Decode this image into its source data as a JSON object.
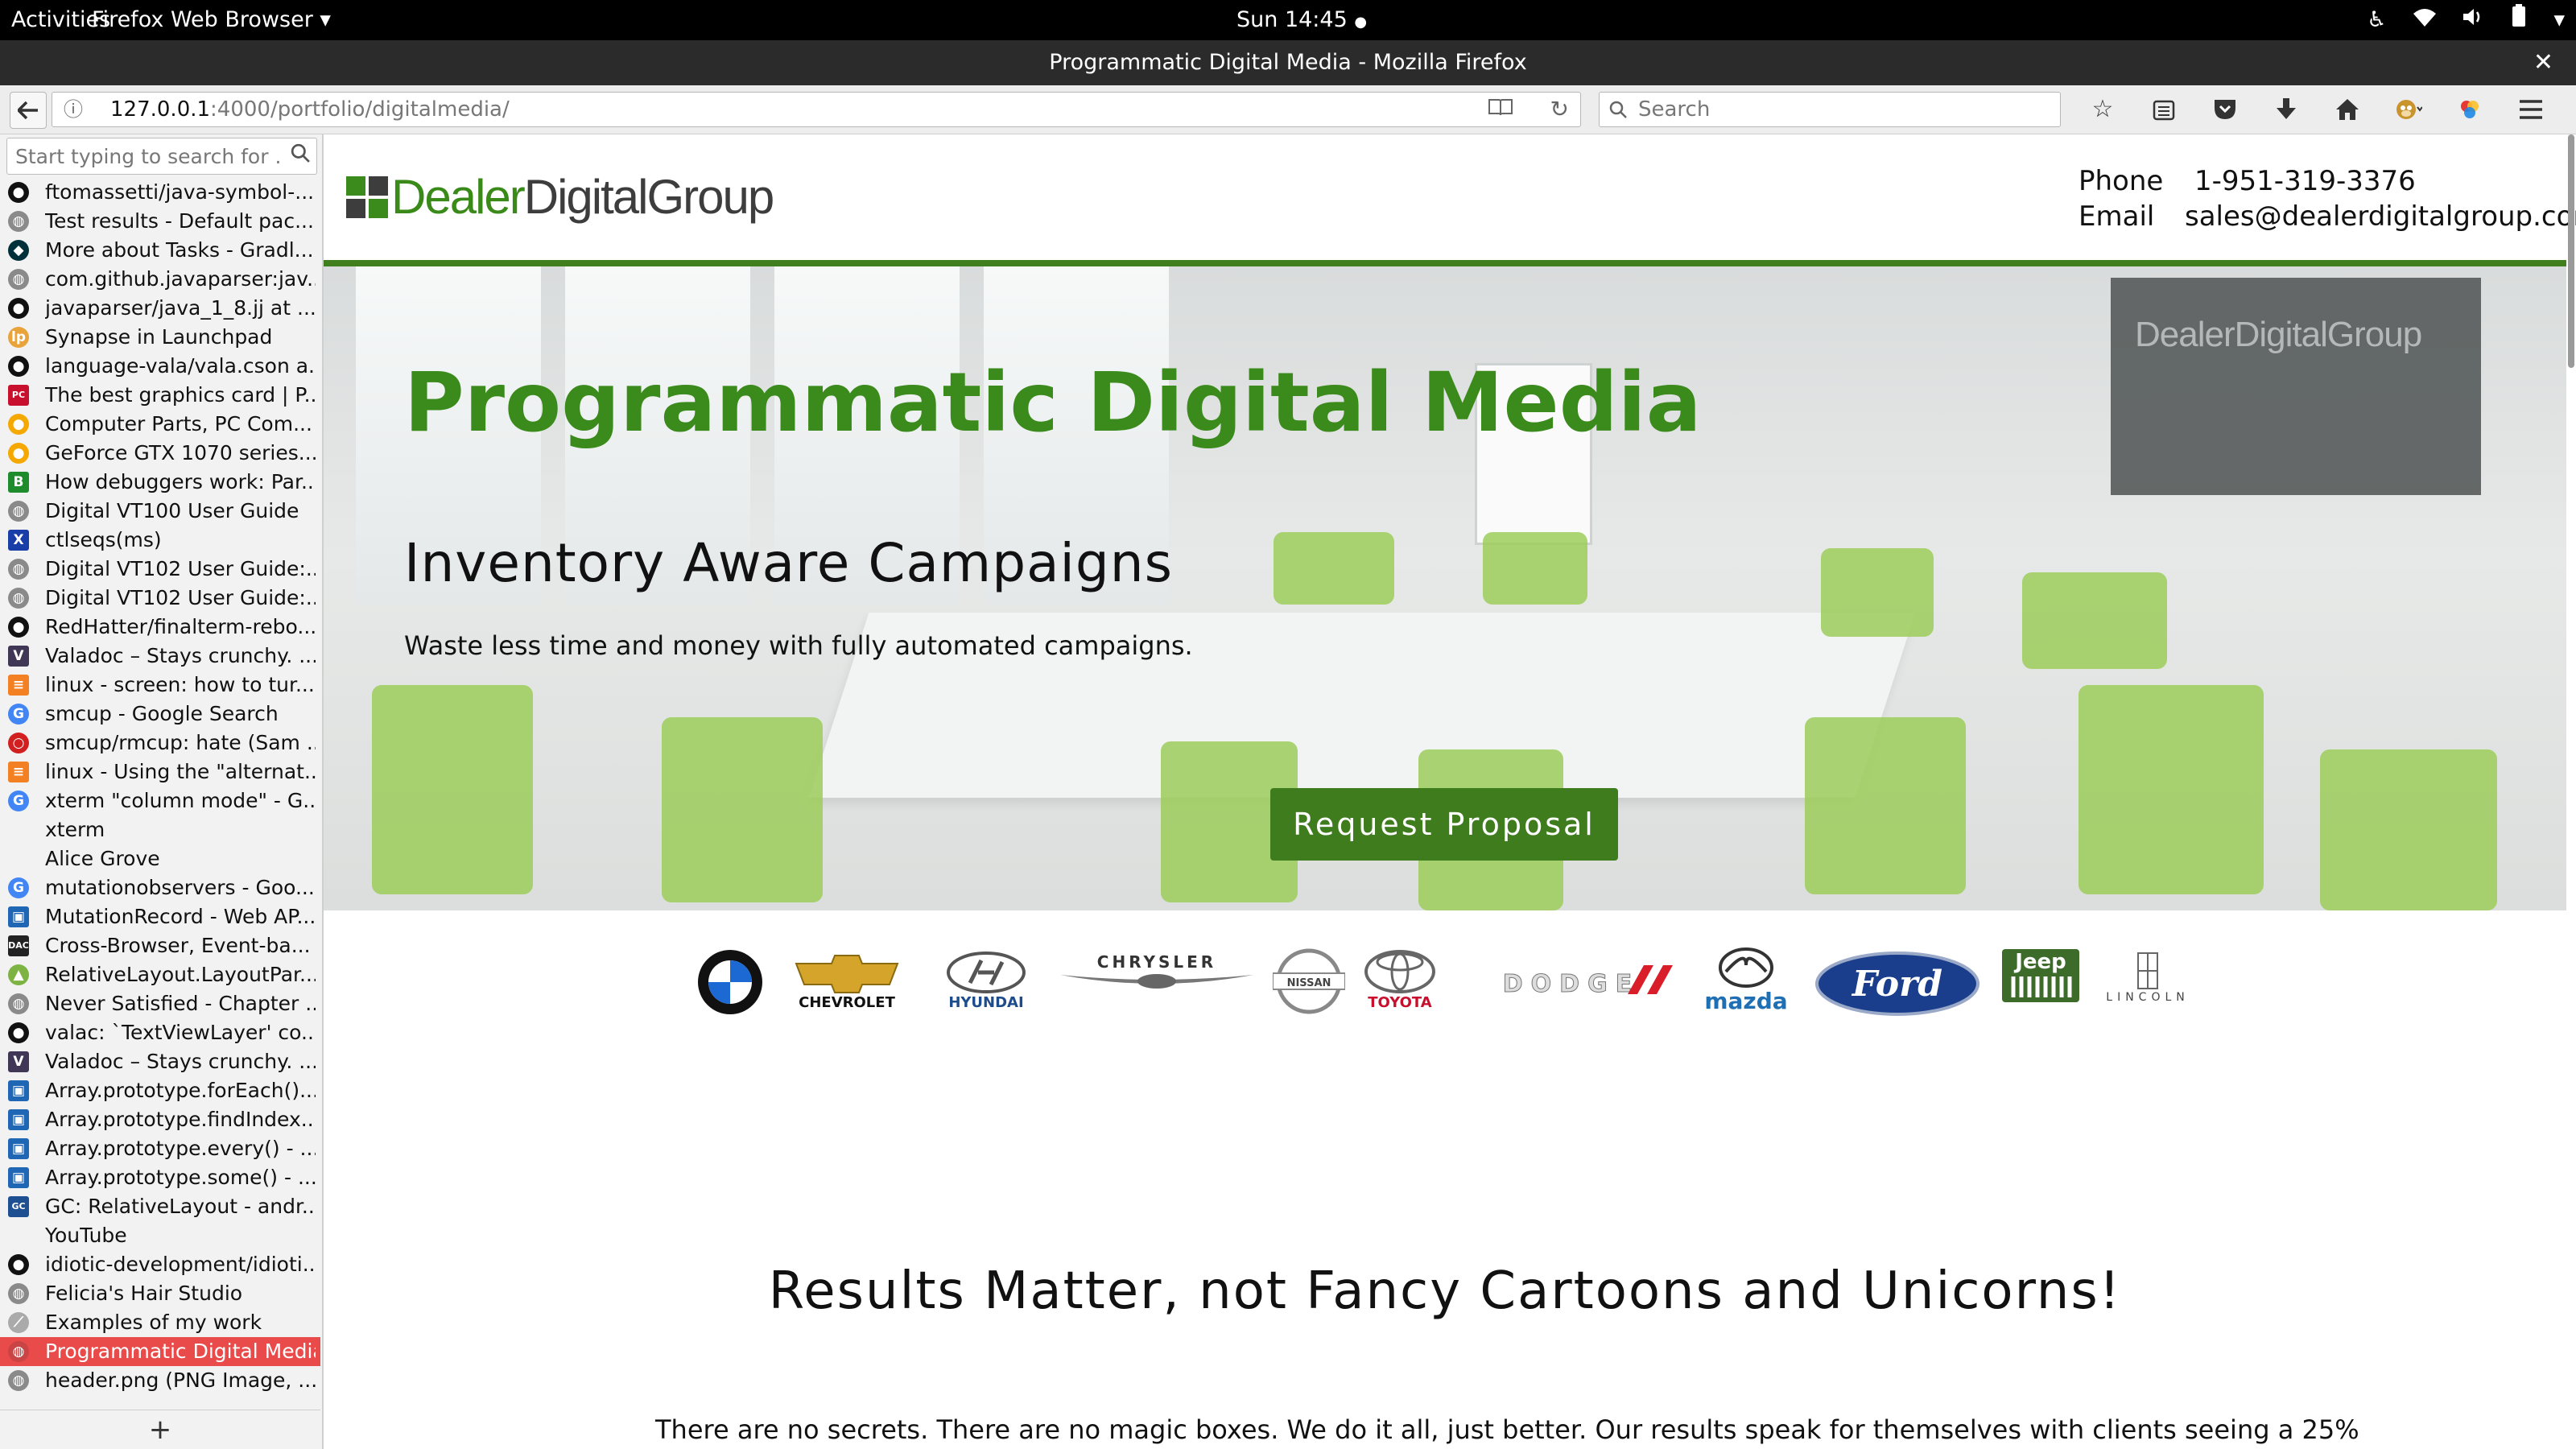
{
  "topbar": {
    "activities": "Activities",
    "app_menu": "Firefox Web Browser",
    "app_menu_arrow": "▾",
    "clock": "Sun 14:45",
    "clock_dot": "●"
  },
  "window": {
    "title": "Programmatic Digital Media - Mozilla Firefox",
    "close_glyph": "✕"
  },
  "navbar": {
    "back_glyph": "🡐",
    "url_host": "127.0.0.1",
    "url_rest": ":4000/portfolio/digitalmedia/",
    "search_placeholder": "Search"
  },
  "icons": {
    "back": "back-arrow-icon",
    "info": "info-icon",
    "reader": "reader-view-icon",
    "reload": "reload-icon",
    "search": "search-icon",
    "bookmark": "bookmark-star-icon",
    "library": "library-icon",
    "pocket": "pocket-icon",
    "download": "download-icon",
    "home": "home-icon",
    "menu": "hamburger-menu-icon"
  },
  "sidebar": {
    "search_placeholder": "Start typing to search for ...",
    "add_label": "+",
    "items": [
      {
        "label": "ftomassetti/java-symbol-...",
        "icon": "github",
        "color": "#111"
      },
      {
        "label": "Test results - Default pac...",
        "icon": "globe",
        "color": "#8a8a8a"
      },
      {
        "label": "More about Tasks - Gradl...",
        "icon": "gradle",
        "color": "#02303a"
      },
      {
        "label": "com.github.javaparser:jav...",
        "icon": "globe",
        "color": "#8a8a8a"
      },
      {
        "label": "javaparser/java_1_8.jj at ...",
        "icon": "github",
        "color": "#111"
      },
      {
        "label": "Synapse in Launchpad",
        "icon": "launchpad",
        "color": "#e8a33a"
      },
      {
        "label": "language-vala/vala.cson a...",
        "icon": "github",
        "color": "#111"
      },
      {
        "label": "The best graphics card | P...",
        "icon": "pcgamer",
        "color": "#c8102e"
      },
      {
        "label": "Computer Parts, PC Com...",
        "icon": "newegg",
        "color": "#f5a800"
      },
      {
        "label": "GeForce GTX 1070 series...",
        "icon": "newegg",
        "color": "#f5a800"
      },
      {
        "label": "How debuggers work: Par...",
        "icon": "blog",
        "color": "#1e8c2c"
      },
      {
        "label": "Digital VT100 User Guide",
        "icon": "globe",
        "color": "#8a8a8a"
      },
      {
        "label": "ctlseqs(ms)",
        "icon": "x",
        "color": "#1a3ea8"
      },
      {
        "label": "Digital VT102 User Guide:...",
        "icon": "globe",
        "color": "#8a8a8a"
      },
      {
        "label": "Digital VT102 User Guide:...",
        "icon": "globe",
        "color": "#8a8a8a"
      },
      {
        "label": "RedHatter/finalterm-rebo...",
        "icon": "github",
        "color": "#111"
      },
      {
        "label": "Valadoc – Stays crunchy. ...",
        "icon": "valadoc",
        "color": "#403757"
      },
      {
        "label": "linux - screen: how to tur...",
        "icon": "stackoverflow",
        "color": "#f48024"
      },
      {
        "label": "smcup - Google Search",
        "icon": "google",
        "color": "#4285f4"
      },
      {
        "label": "smcup/rmcup: hate (Sam ...",
        "icon": "hate",
        "color": "#d21f1f"
      },
      {
        "label": "linux - Using the \"alternat...",
        "icon": "stackoverflow",
        "color": "#f48024"
      },
      {
        "label": "xterm \"column mode\" - G...",
        "icon": "google",
        "color": "#4285f4"
      },
      {
        "label": "xterm",
        "icon": "none",
        "color": "#f2f2f2"
      },
      {
        "label": "Alice Grove",
        "icon": "none",
        "color": "#f2f2f2"
      },
      {
        "label": "mutationobservers - Goo...",
        "icon": "google",
        "color": "#4285f4"
      },
      {
        "label": "MutationRecord - Web AP...",
        "icon": "mdn",
        "color": "#1f66b5"
      },
      {
        "label": "Cross-Browser, Event-ba...",
        "icon": "dac",
        "color": "#222"
      },
      {
        "label": "RelativeLayout.LayoutPar...",
        "icon": "android",
        "color": "#7cb342"
      },
      {
        "label": "Never Satisfied - Chapter ...",
        "icon": "globe",
        "color": "#8a8a8a"
      },
      {
        "label": "valac: `TextViewLayer' co...",
        "icon": "github",
        "color": "#111"
      },
      {
        "label": "Valadoc – Stays crunchy. ...",
        "icon": "valadoc",
        "color": "#403757"
      },
      {
        "label": "Array.prototype.forEach()...",
        "icon": "mdn",
        "color": "#1f66b5"
      },
      {
        "label": "Array.prototype.findIndex...",
        "icon": "mdn",
        "color": "#1f66b5"
      },
      {
        "label": "Array.prototype.every() - ...",
        "icon": "mdn",
        "color": "#1f66b5"
      },
      {
        "label": "Array.prototype.some() - ...",
        "icon": "mdn",
        "color": "#1f66b5"
      },
      {
        "label": "GC: RelativeLayout - andr...",
        "icon": "gc",
        "color": "#1d4f91"
      },
      {
        "label": "YouTube",
        "icon": "none",
        "color": "#f2f2f2"
      },
      {
        "label": "idiotic-development/idioti...",
        "icon": "github",
        "color": "#111"
      },
      {
        "label": "Felicia's Hair Studio",
        "icon": "globe",
        "color": "#8a8a8a"
      },
      {
        "label": "Examples of my work",
        "icon": "pen",
        "color": "#aaa"
      },
      {
        "label": "Programmatic Digital Media",
        "icon": "globe",
        "color": "#c94444",
        "selected": true
      },
      {
        "label": "header.png (PNG Image, ...",
        "icon": "globe",
        "color": "#8a8a8a"
      }
    ]
  },
  "page": {
    "logo_part1": "Dealer",
    "logo_part2": "DigitalGroup",
    "phone_label": "Phone",
    "phone_value": "1-951-319-3376",
    "email_label": "Email",
    "email_value": "sales@dealerdigitalgroup.com",
    "hero_title": "Programmatic Digital Media",
    "hero_subtitle": "Inventory Aware Campaigns",
    "hero_text": "Waste less time and money with fully automated campaigns.",
    "hero_button": "Request Proposal",
    "hero_screen_label": "DealerDigitalGroup",
    "brand_color": "#3b8a1c",
    "brands": [
      "BMW",
      "CHEVROLET",
      "HYUNDAI",
      "CHRYSLER",
      "NISSAN",
      "TOYOTA",
      "DODGE",
      "mazda",
      "Ford",
      "Jeep",
      "LINCOLN"
    ],
    "results_heading": "Results Matter, not Fancy Cartoons and Unicorns!",
    "results_body": "There are no secrets. There are no magic boxes. We do it all, just better. Our results speak for themselves with clients seeing a 25%"
  }
}
